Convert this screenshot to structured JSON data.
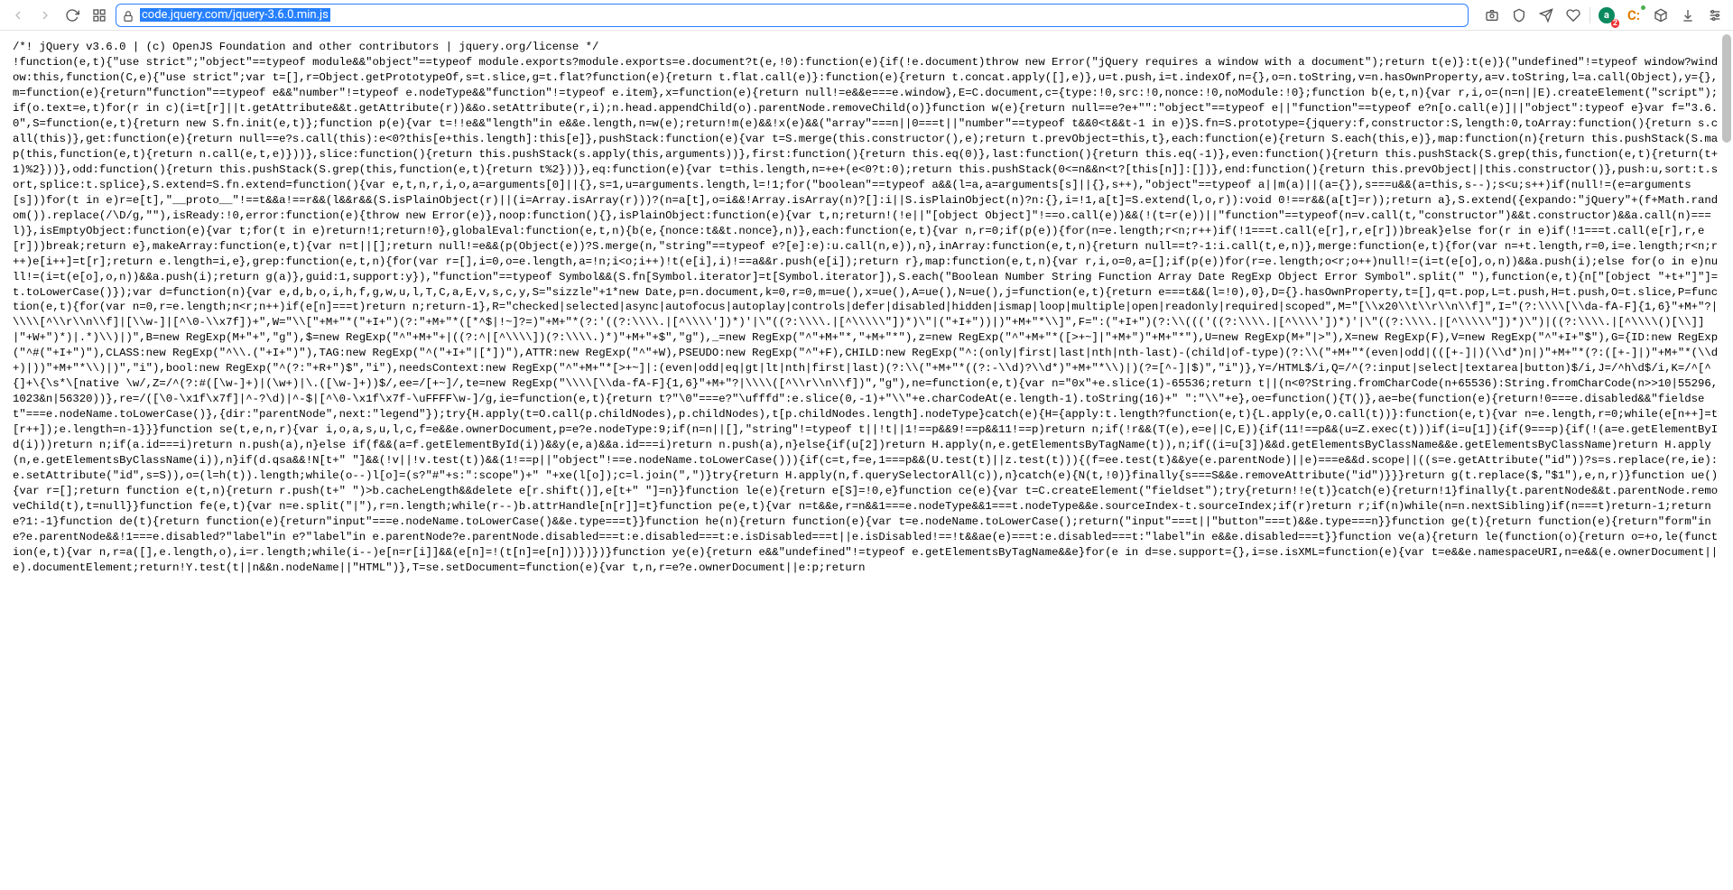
{
  "toolbar": {
    "url": "code.jquery.com/jquery-3.6.0.min.js",
    "extensions": {
      "a_label": "a",
      "a_badge": "2",
      "c_label": "C:"
    }
  },
  "page": {
    "code": "/*! jQuery v3.6.0 | (c) OpenJS Foundation and other contributors | jquery.org/license */\n!function(e,t){\"use strict\";\"object\"==typeof module&&\"object\"==typeof module.exports?module.exports=e.document?t(e,!0):function(e){if(!e.document)throw new Error(\"jQuery requires a window with a document\");return t(e)}:t(e)}(\"undefined\"!=typeof window?window:this,function(C,e){\"use strict\";var t=[],r=Object.getPrototypeOf,s=t.slice,g=t.flat?function(e){return t.flat.call(e)}:function(e){return t.concat.apply([],e)},u=t.push,i=t.indexOf,n={},o=n.toString,v=n.hasOwnProperty,a=v.toString,l=a.call(Object),y={},m=function(e){return\"function\"==typeof e&&\"number\"!=typeof e.nodeType&&\"function\"!=typeof e.item},x=function(e){return null!=e&&e===e.window},E=C.document,c={type:!0,src:!0,nonce:!0,noModule:!0};function b(e,t,n){var r,i,o=(n=n||E).createElement(\"script\");if(o.text=e,t)for(r in c)(i=t[r]||t.getAttribute&&t.getAttribute(r))&&o.setAttribute(r,i);n.head.appendChild(o).parentNode.removeChild(o)}function w(e){return null==e?e+\"\":\"object\"==typeof e||\"function\"==typeof e?n[o.call(e)]||\"object\":typeof e}var f=\"3.6.0\",S=function(e,t){return new S.fn.init(e,t)};function p(e){var t=!!e&&\"length\"in e&&e.length,n=w(e);return!m(e)&&!x(e)&&(\"array\"===n||0===t||\"number\"==typeof t&&0<t&&t-1 in e)}S.fn=S.prototype={jquery:f,constructor:S,length:0,toArray:function(){return s.call(this)},get:function(e){return null==e?s.call(this):e<0?this[e+this.length]:this[e]},pushStack:function(e){var t=S.merge(this.constructor(),e);return t.prevObject=this,t},each:function(e){return S.each(this,e)},map:function(n){return this.pushStack(S.map(this,function(e,t){return n.call(e,t,e)}))},slice:function(){return this.pushStack(s.apply(this,arguments))},first:function(){return this.eq(0)},last:function(){return this.eq(-1)},even:function(){return this.pushStack(S.grep(this,function(e,t){return(t+1)%2}))},odd:function(){return this.pushStack(S.grep(this,function(e,t){return t%2}))},eq:function(e){var t=this.length,n=+e+(e<0?t:0);return this.pushStack(0<=n&&n<t?[this[n]]:[])},end:function(){return this.prevObject||this.constructor()},push:u,sort:t.sort,splice:t.splice},S.extend=S.fn.extend=function(){var e,t,n,r,i,o,a=arguments[0]||{},s=1,u=arguments.length,l=!1;for(\"boolean\"==typeof a&&(l=a,a=arguments[s]||{},s++),\"object\"==typeof a||m(a)||(a={}),s===u&&(a=this,s--);s<u;s++)if(null!=(e=arguments[s]))for(t in e)r=e[t],\"__proto__\"!==t&&a!==r&&(l&&r&&(S.isPlainObject(r)||(i=Array.isArray(r)))?(n=a[t],o=i&&!Array.isArray(n)?[]:i||S.isPlainObject(n)?n:{},i=!1,a[t]=S.extend(l,o,r)):void 0!==r&&(a[t]=r));return a},S.extend({expando:\"jQuery\"+(f+Math.random()).replace(/\\D/g,\"\"),isReady:!0,error:function(e){throw new Error(e)},noop:function(){},isPlainObject:function(e){var t,n;return!(!e||\"[object Object]\"!==o.call(e))&&(!(t=r(e))||\"function\"==typeof(n=v.call(t,\"constructor\")&&t.constructor)&&a.call(n)===l)},isEmptyObject:function(e){var t;for(t in e)return!1;return!0},globalEval:function(e,t,n){b(e,{nonce:t&&t.nonce},n)},each:function(e,t){var n,r=0;if(p(e)){for(n=e.length;r<n;r++)if(!1===t.call(e[r],r,e[r]))break}else for(r in e)if(!1===t.call(e[r],r,e[r]))break;return e},makeArray:function(e,t){var n=t||[];return null!=e&&(p(Object(e))?S.merge(n,\"string\"==typeof e?[e]:e):u.call(n,e)),n},inArray:function(e,t,n){return null==t?-1:i.call(t,e,n)},merge:function(e,t){for(var n=+t.length,r=0,i=e.length;r<n;r++)e[i++]=t[r];return e.length=i,e},grep:function(e,t,n){for(var r=[],i=0,o=e.length,a=!n;i<o;i++)!t(e[i],i)!==a&&r.push(e[i]);return r},map:function(e,t,n){var r,i,o=0,a=[];if(p(e))for(r=e.length;o<r;o++)null!=(i=t(e[o],o,n))&&a.push(i);else for(o in e)null!=(i=t(e[o],o,n))&&a.push(i);return g(a)},guid:1,support:y}),\"function\"==typeof Symbol&&(S.fn[Symbol.iterator]=t[Symbol.iterator]),S.each(\"Boolean Number String Function Array Date RegExp Object Error Symbol\".split(\" \"),function(e,t){n[\"[object \"+t+\"]\"]=t.toLowerCase()});var d=function(n){var e,d,b,o,i,h,f,g,w,u,l,T,C,a,E,v,s,c,y,S=\"sizzle\"+1*new Date,p=n.document,k=0,r=0,m=ue(),x=ue(),A=ue(),N=ue(),j=function(e,t){return e===t&&(l=!0),0},D={}.hasOwnProperty,t=[],q=t.pop,L=t.push,H=t.push,O=t.slice,P=function(e,t){for(var n=0,r=e.length;n<r;n++)if(e[n]===t)return n;return-1},R=\"checked|selected|async|autofocus|autoplay|controls|defer|disabled|hidden|ismap|loop|multiple|open|readonly|required|scoped\",M=\"[\\\\x20\\\\t\\\\r\\\\n\\\\f]\",I=\"(?:\\\\\\\\[\\\\da-fA-F]{1,6}\"+M+\"?|\\\\\\\\[^\\\\r\\\\n\\\\f]|[\\\\w-]|[^\\0-\\\\x7f])+\",W=\"\\\\[\"+M+\"*(\"+I+\")(?:\"+M+\"*([*^$|!~]?=)\"+M+\"*(?:'((?:\\\\\\\\.|[^\\\\\\\\'])*)'|\\\"((?:\\\\\\\\.|[^\\\\\\\\\\\"])*)\\\"|(\"+I+\"))|)\"+M+\"*\\\\]\",F=\":(\"+I+\")(?:\\\\((('((?:\\\\\\\\.|[^\\\\\\\\'])*)'|\\\"((?:\\\\\\\\.|[^\\\\\\\\\\\"])*)\\\")|((?:\\\\\\\\.|[^\\\\\\\\()[\\\\]]|\"+W+\")*)|.*)\\\\)|)\",B=new RegExp(M+\"+\",\"g\"),$=new RegExp(\"^\"+M+\"+|((?:^|[^\\\\\\\\])(?:\\\\\\\\.)*)\"+M+\"+$\",\"g\"),_=new RegExp(\"^\"+M+\"*,\"+M+\"*\"),z=new RegExp(\"^\"+M+\"*([>+~]|\"+M+\")\"+M+\"*\"),U=new RegExp(M+\"|>\"),X=new RegExp(F),V=new RegExp(\"^\"+I+\"$\"),G={ID:new RegExp(\"^#(\"+I+\")\"),CLASS:new RegExp(\"^\\\\.(\"+I+\")\"),TAG:new RegExp(\"^(\"+I+\"|[*])\"),ATTR:new RegExp(\"^\"+W),PSEUDO:new RegExp(\"^\"+F),CHILD:new RegExp(\"^:(only|first|last|nth|nth-last)-(child|of-type)(?:\\\\(\"+M+\"*(even|odd|(([+-]|)(\\\\d*)n|)\"+M+\"*(?:([+-]|)\"+M+\"*(\\\\d+)|))\"+M+\"*\\\\)|)\",\"i\"),bool:new RegExp(\"^(?:\"+R+\")$\",\"i\"),needsContext:new RegExp(\"^\"+M+\"*[>+~]|:(even|odd|eq|gt|lt|nth|first|last)(?:\\\\(\"+M+\"*((?:-\\\\d)?\\\\d*)\"+M+\"*\\\\)|)(?=[^-]|$)\",\"i\")},Y=/HTML$/i,Q=/^(?:input|select|textarea|button)$/i,J=/^h\\d$/i,K=/^[^{]+\\{\\s*\\[native \\w/,Z=/^(?:#([\\w-]+)|(\\w+)|\\.([\\w-]+))$/,ee=/[+~]/,te=new RegExp(\"\\\\\\\\[\\\\da-fA-F]{1,6}\"+M+\"?|\\\\\\\\([^\\\\r\\\\n\\\\f])\",\"g\"),ne=function(e,t){var n=\"0x\"+e.slice(1)-65536;return t||(n<0?String.fromCharCode(n+65536):String.fromCharCode(n>>10|55296,1023&n|56320))},re=/([\\0-\\x1f\\x7f]|^-?\\d)|^-$|[^\\0-\\x1f\\x7f-\\uFFFF\\w-]/g,ie=function(e,t){return t?\"\\0\"===e?\"\\ufffd\":e.slice(0,-1)+\"\\\\\"+e.charCodeAt(e.length-1).toString(16)+\" \":\"\\\\\"+e},oe=function(){T()},ae=be(function(e){return!0===e.disabled&&\"fieldset\"===e.nodeName.toLowerCase()},{dir:\"parentNode\",next:\"legend\"});try{H.apply(t=O.call(p.childNodes),p.childNodes),t[p.childNodes.length].nodeType}catch(e){H={apply:t.length?function(e,t){L.apply(e,O.call(t))}:function(e,t){var n=e.length,r=0;while(e[n++]=t[r++]);e.length=n-1}}}function se(t,e,n,r){var i,o,a,s,u,l,c,f=e&&e.ownerDocument,p=e?e.nodeType:9;if(n=n||[],\"string\"!=typeof t||!t||1!==p&&9!==p&&11!==p)return n;if(!r&&(T(e),e=e||C,E)){if(11!==p&&(u=Z.exec(t)))if(i=u[1]){if(9===p){if(!(a=e.getElementById(i)))return n;if(a.id===i)return n.push(a),n}else if(f&&(a=f.getElementById(i))&&y(e,a)&&a.id===i)return n.push(a),n}else{if(u[2])return H.apply(n,e.getElementsByTagName(t)),n;if((i=u[3])&&d.getElementsByClassName&&e.getElementsByClassName)return H.apply(n,e.getElementsByClassName(i)),n}if(d.qsa&&!N[t+\" \"]&&(!v||!v.test(t))&&(1!==p||\"object\"!==e.nodeName.toLowerCase())){if(c=t,f=e,1===p&&(U.test(t)||z.test(t))){(f=ee.test(t)&&ye(e.parentNode)||e)===e&&d.scope||((s=e.getAttribute(\"id\"))?s=s.replace(re,ie):e.setAttribute(\"id\",s=S)),o=(l=h(t)).length;while(o--)l[o]=(s?\"#\"+s:\":scope\")+\" \"+xe(l[o]);c=l.join(\",\")}try{return H.apply(n,f.querySelectorAll(c)),n}catch(e){N(t,!0)}finally{s===S&&e.removeAttribute(\"id\")}}}return g(t.replace($,\"$1\"),e,n,r)}function ue(){var r=[];return function e(t,n){return r.push(t+\" \")>b.cacheLength&&delete e[r.shift()],e[t+\" \"]=n}}function le(e){return e[S]=!0,e}function ce(e){var t=C.createElement(\"fieldset\");try{return!!e(t)}catch(e){return!1}finally{t.parentNode&&t.parentNode.removeChild(t),t=null}}function fe(e,t){var n=e.split(\"|\"),r=n.length;while(r--)b.attrHandle[n[r]]=t}function pe(e,t){var n=t&&e,r=n&&1===e.nodeType&&1===t.nodeType&&e.sourceIndex-t.sourceIndex;if(r)return r;if(n)while(n=n.nextSibling)if(n===t)return-1;return e?1:-1}function de(t){return function(e){return\"input\"===e.nodeName.toLowerCase()&&e.type===t}}function he(n){return function(e){var t=e.nodeName.toLowerCase();return(\"input\"===t||\"button\"===t)&&e.type===n}}function ge(t){return function(e){return\"form\"in e?e.parentNode&&!1===e.disabled?\"label\"in e?\"label\"in e.parentNode?e.parentNode.disabled===t:e.disabled===t:e.isDisabled===t||e.isDisabled!==!t&&ae(e)===t:e.disabled===t:\"label\"in e&&e.disabled===t}}function ve(a){return le(function(o){return o=+o,le(function(e,t){var n,r=a([],e.length,o),i=r.length;while(i--)e[n=r[i]]&&(e[n]=!(t[n]=e[n]))})})}function ye(e){return e&&\"undefined\"!=typeof e.getElementsByTagName&&e}for(e in d=se.support={},i=se.isXML=function(e){var t=e&&e.namespaceURI,n=e&&(e.ownerDocument||e).documentElement;return!Y.test(t||n&&n.nodeName||\"HTML\")},T=se.setDocument=function(e){var t,n,r=e?e.ownerDocument||e:p;return"
  }
}
